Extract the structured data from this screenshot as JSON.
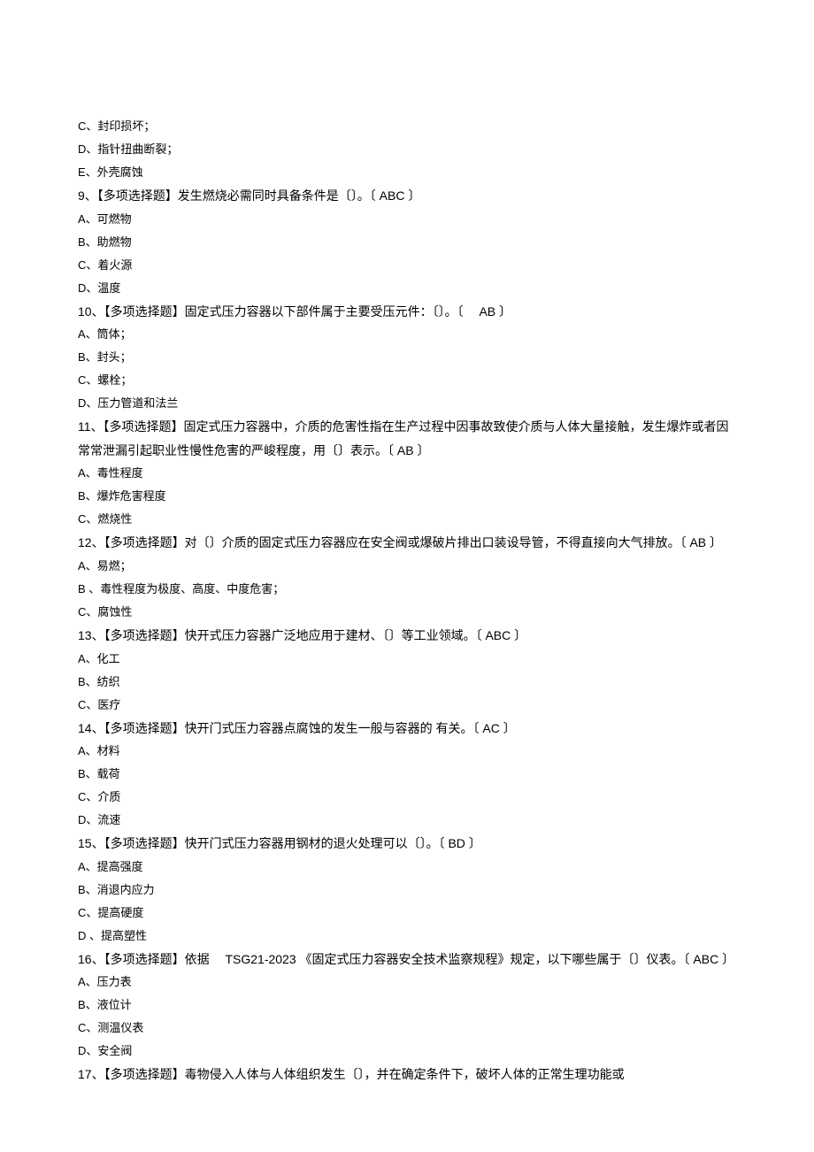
{
  "lines": [
    {
      "cls": "opt",
      "text": "C、封印损坏；"
    },
    {
      "cls": "opt",
      "text": "D、指针扭曲断裂；"
    },
    {
      "cls": "opt",
      "text": "E、外壳腐蚀"
    },
    {
      "cls": "q",
      "text": "9、【多项选择题】发生燃烧必需同时具备条件是〔〕。〔 ABC  〕"
    },
    {
      "cls": "opt",
      "text": "A、可燃物"
    },
    {
      "cls": "opt",
      "text": "B、助燃物"
    },
    {
      "cls": "opt",
      "text": "C、着火源"
    },
    {
      "cls": "opt",
      "text": "D、温度"
    },
    {
      "cls": "q",
      "text": "10、【多项选择题】固定式压力容器以下部件属于主要受压元件：〔〕。〔　 AB  〕"
    },
    {
      "cls": "opt",
      "text": "A、筒体；"
    },
    {
      "cls": "opt",
      "text": "B、封头；"
    },
    {
      "cls": "opt",
      "text": "C、螺栓；"
    },
    {
      "cls": "opt",
      "text": "D、压力管道和法兰"
    },
    {
      "cls": "q",
      "text": "11、【多项选择题】固定式压力容器中，介质的危害性指在生产过程中因事故致使介质与人体大量接触，发生爆炸或者因常常泄漏引起职业性慢性危害的严峻程度，用〔〕表示。〔  AB  〕"
    },
    {
      "cls": "opt",
      "text": "A、毒性程度"
    },
    {
      "cls": "opt",
      "text": "B、爆炸危害程度"
    },
    {
      "cls": "opt",
      "text": "C、燃烧性"
    },
    {
      "cls": "q",
      "text": "12、【多项选择题】对〔〕介质的固定式压力容器应在安全阀或爆破片排出口装设导管，不得直接向大气排放。〔  AB  〕"
    },
    {
      "cls": "opt",
      "text": "A、易燃；"
    },
    {
      "cls": "opt",
      "text": "B 、毒性程度为极度、高度、中度危害；"
    },
    {
      "cls": "opt",
      "text": "C、腐蚀性"
    },
    {
      "cls": "q",
      "text": "13、【多项选择题】快开式压力容器广泛地应用于建材、〔〕等工业领域。〔  ABC  〕"
    },
    {
      "cls": "opt",
      "text": "A、化工"
    },
    {
      "cls": "opt",
      "text": "B、纺织"
    },
    {
      "cls": "opt",
      "text": "C、医疗"
    },
    {
      "cls": "q",
      "text": "14、【多项选择题】快开门式压力容器点腐蚀的发生一般与容器的   有关。〔  AC  〕"
    },
    {
      "cls": "opt",
      "text": "A、材料"
    },
    {
      "cls": "opt",
      "text": "B、载荷"
    },
    {
      "cls": "opt",
      "text": "C、介质"
    },
    {
      "cls": "opt",
      "text": "D、流速"
    },
    {
      "cls": "q",
      "text": "15、【多项选择题】快开门式压力容器用钢材的退火处理可以〔〕。〔  BD  〕"
    },
    {
      "cls": "opt",
      "text": "A、提高强度"
    },
    {
      "cls": "opt",
      "text": "B、消退内应力"
    },
    {
      "cls": "opt",
      "text": "C、提高硬度"
    },
    {
      "cls": "opt",
      "text": "D 、提高塑性"
    },
    {
      "cls": "q",
      "text": "16、【多项选择题】依据　 TSG21-2023 《固定式压力容器安全技术监察规程》规定，以下哪些属于〔〕仪表。〔  ABC 〕"
    },
    {
      "cls": "opt",
      "text": "A、压力表"
    },
    {
      "cls": "opt",
      "text": "B、液位计"
    },
    {
      "cls": "opt",
      "text": "C、测温仪表"
    },
    {
      "cls": "opt",
      "text": "D、安全阀"
    },
    {
      "cls": "q",
      "text": "17、【多项选择题】毒物侵入人体与人体组织发生〔〕，并在确定条件下，破坏人体的正常生理功能或"
    }
  ]
}
